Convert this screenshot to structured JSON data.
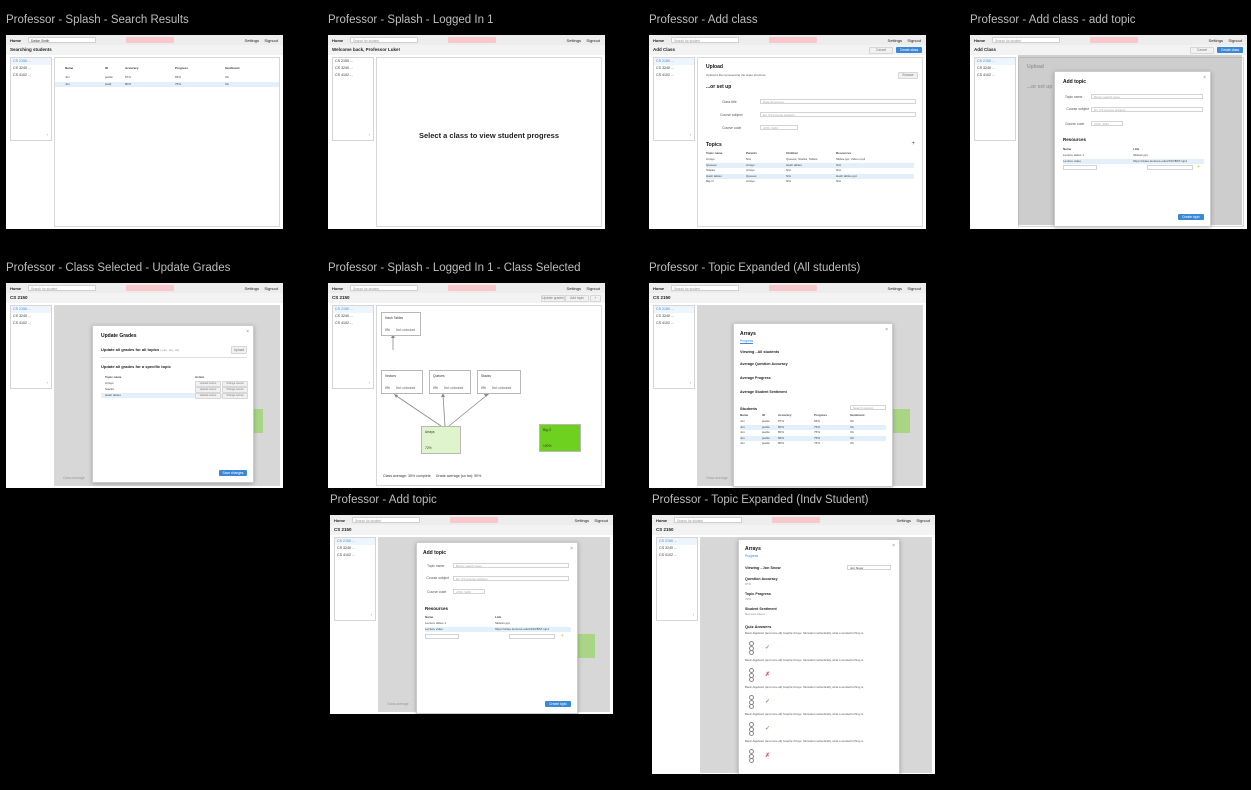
{
  "common": {
    "home": "Home",
    "settings": "Settings",
    "signout": "Signout",
    "search_placeholder": "Search for student",
    "classes": [
      "CS 2150 ...",
      "CS 3240 ...",
      "CS 4102 ..."
    ]
  },
  "frames": [
    {
      "title": "Professor - Splash - Search Results",
      "search_value": "Dalton Smith",
      "header": "Searching students",
      "table_headers": [
        "Name",
        "ID",
        "Accuracy",
        "Progress",
        "Sentiment"
      ],
      "rows": [
        [
          "Jon",
          "jsa4w",
          "87%",
          "65%",
          "Ok"
        ],
        [
          "Jon",
          "jsa3j",
          "80%",
          "75%",
          "Ok"
        ]
      ]
    },
    {
      "title": "Professor - Splash - Logged In 1",
      "header": "Welcome back, Professor Luke!",
      "center_text": "Select a class to view student progress"
    },
    {
      "title": "Professor - Add class",
      "header": "Add Class",
      "cancel": "Cancel",
      "create": "Create class",
      "upload_title": "Upload",
      "upload_desc": "Upload a file representing the class structure",
      "browse": "Browse",
      "or_setup": "...or set up",
      "fields": [
        {
          "label": "Class title",
          "placeholder": "Data Structures"
        },
        {
          "label": "Course subject",
          "placeholder": "Ex: CS (course subject)"
        },
        {
          "label": "Course code",
          "placeholder": "2150, 3240"
        }
      ],
      "topics_title": "Topics",
      "topics_headers": [
        "Topic name",
        "Parents",
        "Children",
        "Resources"
      ],
      "topics_rows": [
        [
          "Arrays",
          "N/A",
          "Queues, Stacks, Tables",
          "Slides.ppt, Video.mp4"
        ],
        [
          "Queues",
          "Arrays",
          "Hash tables",
          "N/A"
        ],
        [
          "Stacks",
          "Arrays",
          "N/A",
          "N/A"
        ],
        [
          "Hash tables",
          "Queues",
          "N/A",
          "Hash tables.ppt"
        ],
        [
          "Big-O",
          "Arrays",
          "N/A",
          "N/A"
        ]
      ]
    },
    {
      "title": "Professor - Add class - add topic",
      "modal_title": "Add topic",
      "fields": [
        {
          "label": "Topic name",
          "placeholder": "Binary search trees"
        },
        {
          "label": "Course subject",
          "placeholder": "Ex: CS (course subject)"
        },
        {
          "label": "Course code",
          "placeholder": "2150, 3240"
        }
      ],
      "resources_title": "Resources",
      "res_headers": [
        "Name",
        "Link"
      ],
      "res_rows": [
        [
          "Lecture slides 1",
          "Slides1.ppt"
        ],
        [
          "Lecture video",
          "https://video.lectures.edu/2150/BST.mp4"
        ]
      ],
      "create_btn": "Create topic"
    },
    {
      "title": "Professor - Class Selected - Update Grades",
      "header": "CS 2150",
      "modal_title": "Update Grades",
      "all_topics_text": "Update all grades for all topics",
      "all_topics_hint": "(.csv, .tsv, .txt)",
      "upload": "Upload",
      "specific_text": "Update all grades for a specific topic",
      "headers": [
        "Topic name",
        "Action"
      ],
      "rows": [
        "Arrays",
        "Stacks",
        "Hash tables"
      ],
      "row_action1": "Upload scores",
      "row_action2": "Change scores",
      "save_btn": "Save changes",
      "class_avg": "Class average"
    },
    {
      "title": "Professor - Splash - Logged In 1 - Class Selected",
      "header": "CS 2150",
      "btn_update": "Update grades",
      "btn_add": "Add topic",
      "nodes": [
        {
          "name": "Hash Tables",
          "pct": "0%",
          "status": "Not unlocked"
        },
        {
          "name": "Vectors",
          "pct": "0%",
          "status": "Not unlocked"
        },
        {
          "name": "Queues",
          "pct": "0%",
          "status": "Not unlocked"
        },
        {
          "name": "Stacks",
          "pct": "0%",
          "status": "Not unlocked"
        },
        {
          "name": "Arrays",
          "pct": "72%",
          "status": ""
        },
        {
          "name": "Big O",
          "pct": "100%",
          "status": ""
        }
      ],
      "footer": "Class average: 35% complete     Grade average (so far): 90%"
    },
    {
      "title": "Professor - Topic Expanded (All students)",
      "header": "CS 2150",
      "modal_title": "Arrays",
      "tab": "Progress",
      "viewing": "Viewing - All students",
      "metrics": [
        "Average Question Accuracy",
        "Average Progress",
        "Average Student Sentiment"
      ],
      "students_title": "Students",
      "search_placeholder": "Search student",
      "headers": [
        "Name",
        "ID",
        "Accuracy",
        "Progress",
        "Sentiment"
      ],
      "rows": [
        [
          "Jon",
          "jsa4w",
          "87%",
          "65%",
          "Ok"
        ],
        [
          "Jon",
          "jsa4w",
          "80%",
          "75%",
          "Ok"
        ],
        [
          "Jon",
          "jsa4w",
          "80%",
          "75%",
          "Ok"
        ],
        [
          "Jon",
          "jsa4w",
          "80%",
          "75%",
          "Ok"
        ],
        [
          "Jon",
          "jsa4w",
          "80%",
          "75%",
          "Ok"
        ]
      ],
      "class_avg": "Class average"
    },
    {
      "title": "Professor - Add topic",
      "header": "CS 2150",
      "modal_title": "Add topic",
      "fields": [
        {
          "label": "Topic name",
          "placeholder": "Binary search trees"
        },
        {
          "label": "Course subject",
          "placeholder": "Ex: CS (course subject)"
        },
        {
          "label": "Course code",
          "placeholder": "2150, 3240"
        }
      ],
      "resources_title": "Resources",
      "res_headers": [
        "Name",
        "Link"
      ],
      "res_rows": [
        [
          "Lecture slides 1",
          "Slides1.ppt"
        ],
        [
          "Lecture video",
          "https://video.lectures.edu/2150/BST.mp4"
        ]
      ],
      "create_btn": "Create topic",
      "class_avg": "Class average"
    },
    {
      "title": "Professor - Topic Expanded (Indv Student)",
      "header": "CS 2150",
      "modal_title": "Arrays",
      "tab": "Progress",
      "viewing": "Viewing - Jon Snow",
      "select_value": "Jon Snow",
      "metrics": [
        {
          "label": "Question Accuracy",
          "value": "87%"
        },
        {
          "label": "Topic Progress",
          "value": "70%"
        },
        {
          "label": "Student Sentiment",
          "value": "Not sure about..."
        }
      ],
      "quiz_title": "Quiz Answers",
      "question": "Basic Algebraic (and more all) Graphic Arrays. Stimulant methodically, what a wonderful thing is."
    }
  ]
}
